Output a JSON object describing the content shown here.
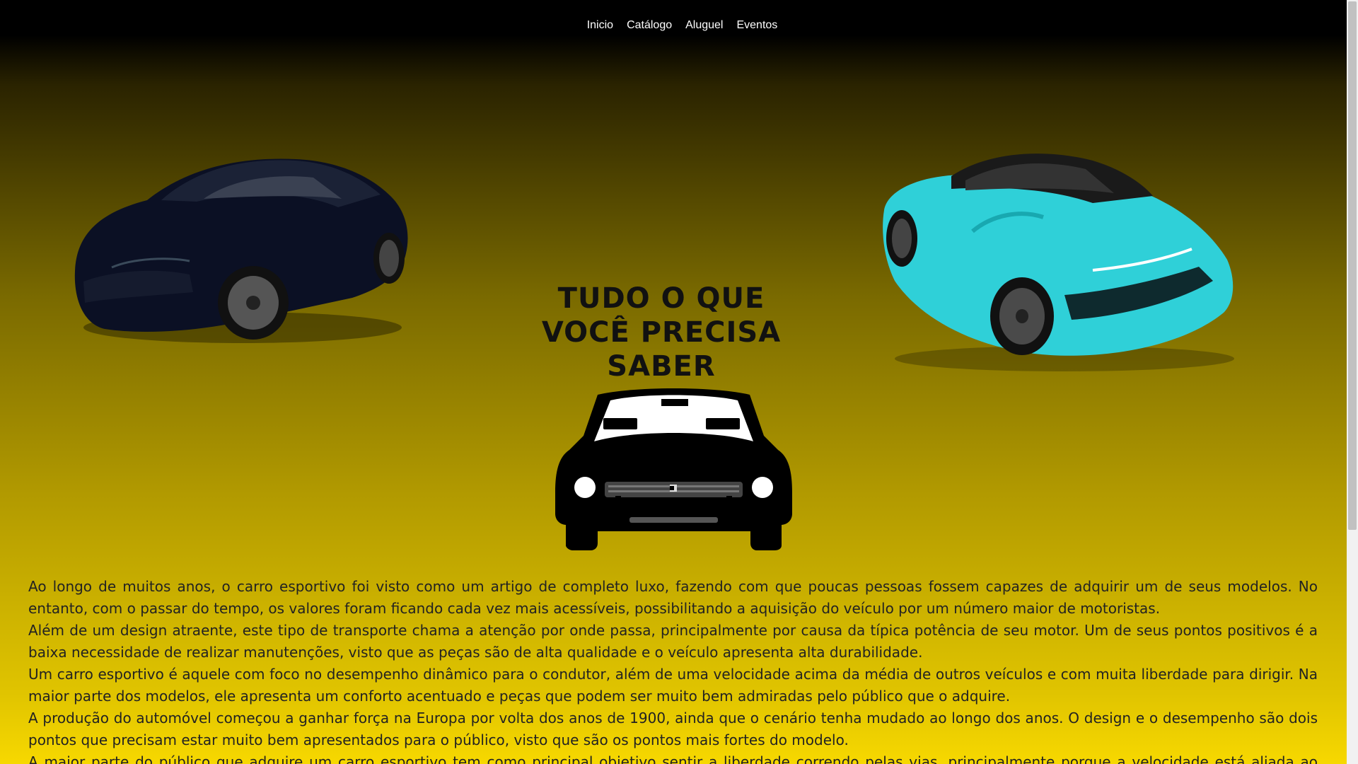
{
  "nav": {
    "items": [
      {
        "label": "Inicio"
      },
      {
        "label": "Catálogo"
      },
      {
        "label": "Aluguel"
      },
      {
        "label": "Eventos"
      }
    ]
  },
  "hero": {
    "headline_line1": "TUDO O QUE",
    "headline_line2": "VOCÊ PRECISA",
    "headline_line3": "SABER"
  },
  "content": {
    "paragraphs": [
      "Ao longo de muitos anos, o carro esportivo foi visto como um artigo de completo luxo, fazendo com que poucas pessoas fossem capazes de adquirir um de seus modelos. No entanto, com o passar do tempo, os valores foram ficando cada vez mais acessíveis, possibilitando a aquisição do veículo por um número maior de motoristas.",
      "Além de um design atraente, este tipo de transporte chama a atenção por onde passa, principalmente por causa da típica potência de seu motor. Um de seus pontos positivos é a baixa necessidade de realizar manutenções, visto que as peças são de alta qualidade e o veículo apresenta alta durabilidade.",
      "Um carro esportivo é aquele com foco no desempenho dinâmico para o condutor, além de uma velocidade acima da média de outros veículos e com muita liberdade para dirigir. Na maior parte dos modelos, ele apresenta um conforto acentuado e peças que podem ser muito bem admiradas pelo público que o adquire.",
      "A produção do automóvel começou a ganhar força na Europa por volta dos anos de 1900, ainda que o cenário tenha mudado ao longo dos anos. O design e o desempenho são dois pontos que precisam estar muito bem apresentados para o público, visto que são os pontos mais fortes do modelo.",
      "A maior parte do público que adquire um carro esportivo tem como principal objetivo sentir a liberdade correndo pelas vias, principalmente porque a velocidade está aliada ao modelo. Já imaginou"
    ]
  },
  "colors": {
    "nav_background": "#000000",
    "nav_text": "#ffffff",
    "gradient_top": "#000000",
    "gradient_bottom": "#f7d800",
    "left_car_body": "#0b1024",
    "right_car_body": "#2fd0d8"
  },
  "icons": {
    "silhouette": "car-front-silhouette-icon"
  }
}
